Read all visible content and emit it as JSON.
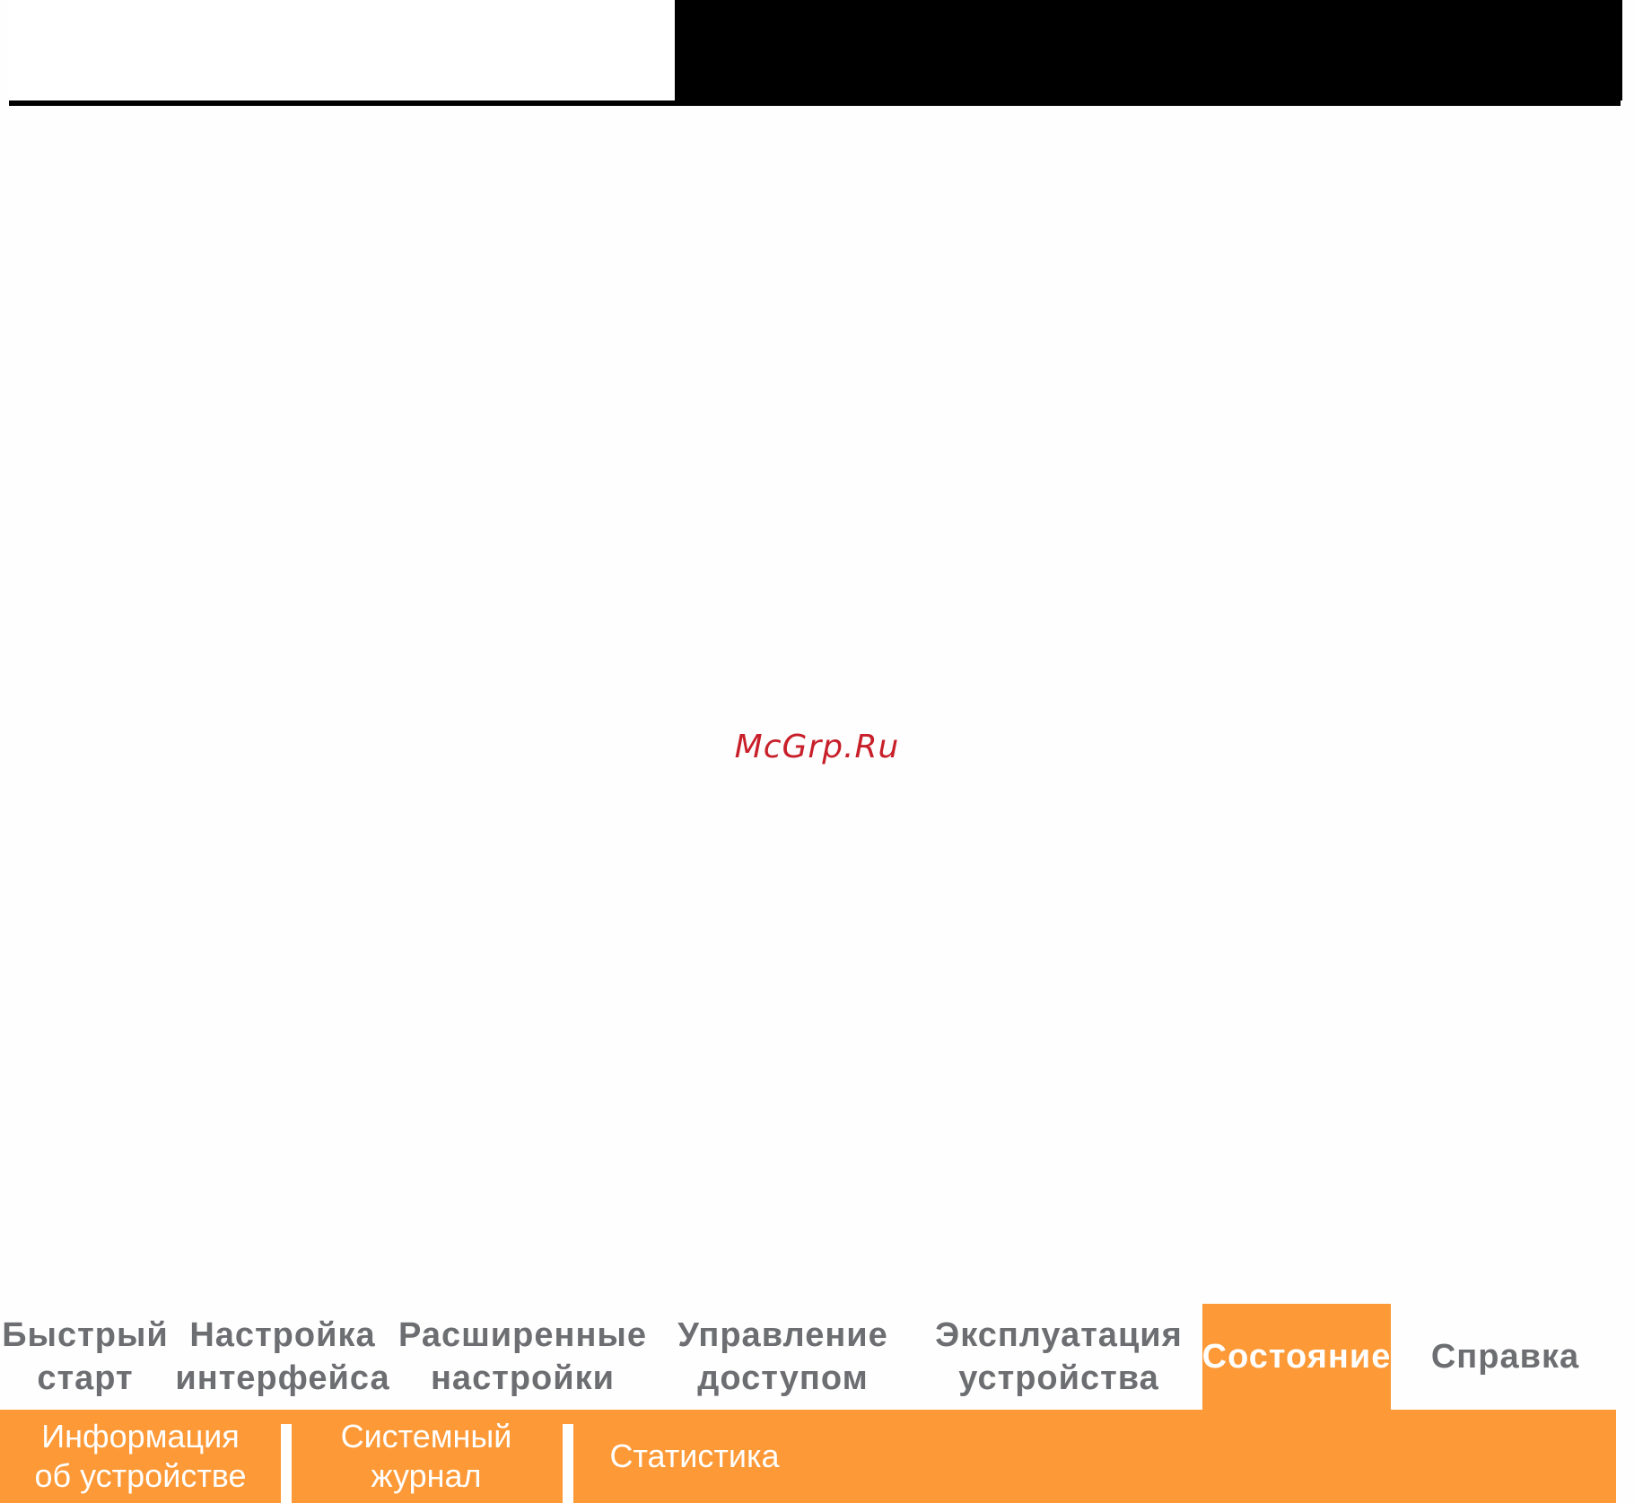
{
  "watermark": "McGrp.Ru",
  "main_nav": {
    "items": [
      {
        "label": "Быстрый\nстарт"
      },
      {
        "label": "Настройка\nинтерфейса"
      },
      {
        "label": "Расширенные\nнастройки"
      },
      {
        "label": "Управление\nдоступом"
      },
      {
        "label": "Эксплуатация\nустройства"
      },
      {
        "label": "Состояние",
        "active": true
      },
      {
        "label": "Справка"
      }
    ]
  },
  "sub_nav": {
    "items": [
      {
        "label": "Информация\nоб устройстве"
      },
      {
        "label": "Системный\nжурнал"
      },
      {
        "label": "Статистика"
      }
    ]
  },
  "colors": {
    "accent": "#fd9936",
    "nav_text": "#6d6e71",
    "watermark": "#c8202a"
  }
}
